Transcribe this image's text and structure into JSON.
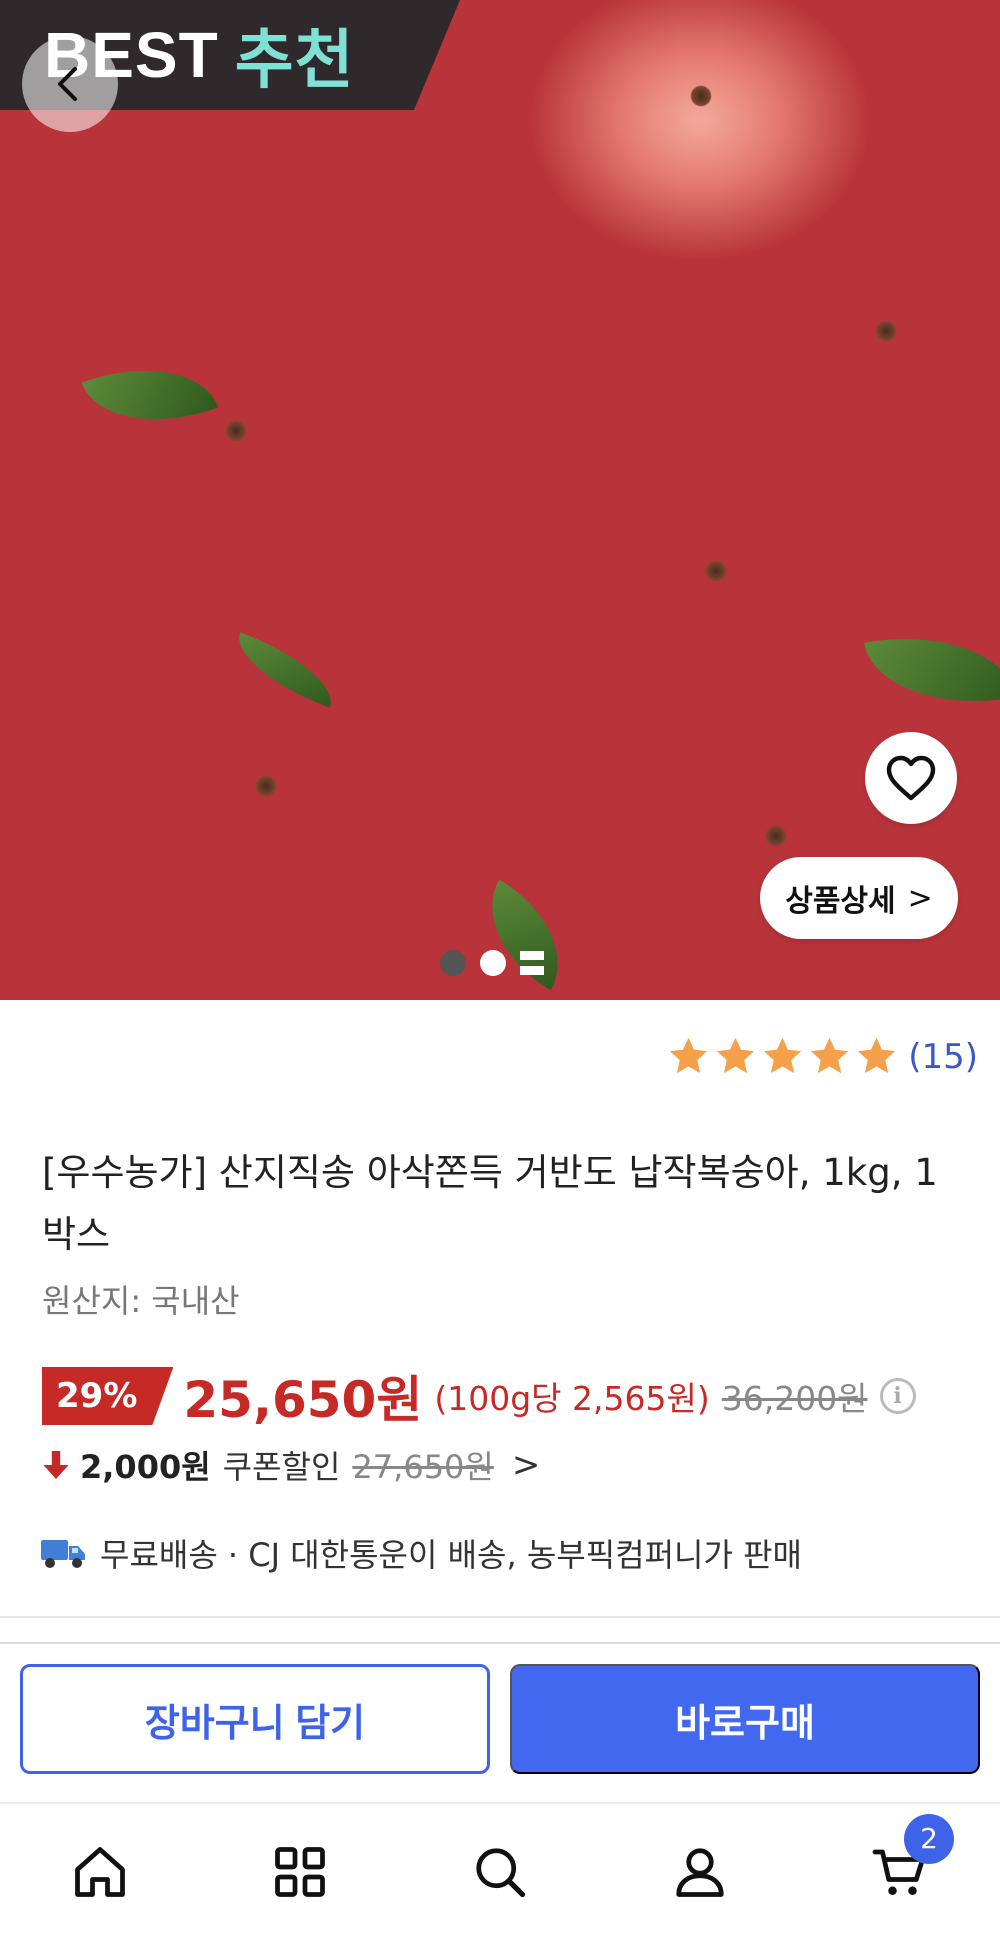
{
  "hero": {
    "banner_en": "BEST",
    "banner_ko": "추천",
    "detail_label": "상품상세",
    "detail_chevron": ">",
    "carousel_pages": 3,
    "carousel_active": 1
  },
  "rating": {
    "stars": 5,
    "count": "(15)",
    "star_color": "#f5a04a"
  },
  "product": {
    "title": "[우수농가] 산지직송 아삭쫀득 거반도 납작복숭아, 1kg, 1박스",
    "origin": "원산지: 국내산"
  },
  "price": {
    "discount": "29%",
    "sale": "25,650원",
    "unit": "(100g당 2,565원)",
    "original": "36,200원",
    "info_icon": "i"
  },
  "coupon": {
    "amount": "2,000원",
    "label": "쿠폰할인",
    "price": "27,650원",
    "chevron": ">"
  },
  "shipping": {
    "text": "무료배송 · CJ 대한통운이 배송, 농부픽컴퍼니가 판매"
  },
  "actions": {
    "cart_label": "장바구니 담기",
    "buy_label": "바로구매"
  },
  "nav": {
    "items": [
      "home-icon",
      "category-icon",
      "search-icon",
      "my-page-icon",
      "cart-icon"
    ],
    "cart_count": "2"
  },
  "colors": {
    "accent": "#4268f0",
    "sale": "#c62a26",
    "rating_count": "#3a58c4"
  }
}
